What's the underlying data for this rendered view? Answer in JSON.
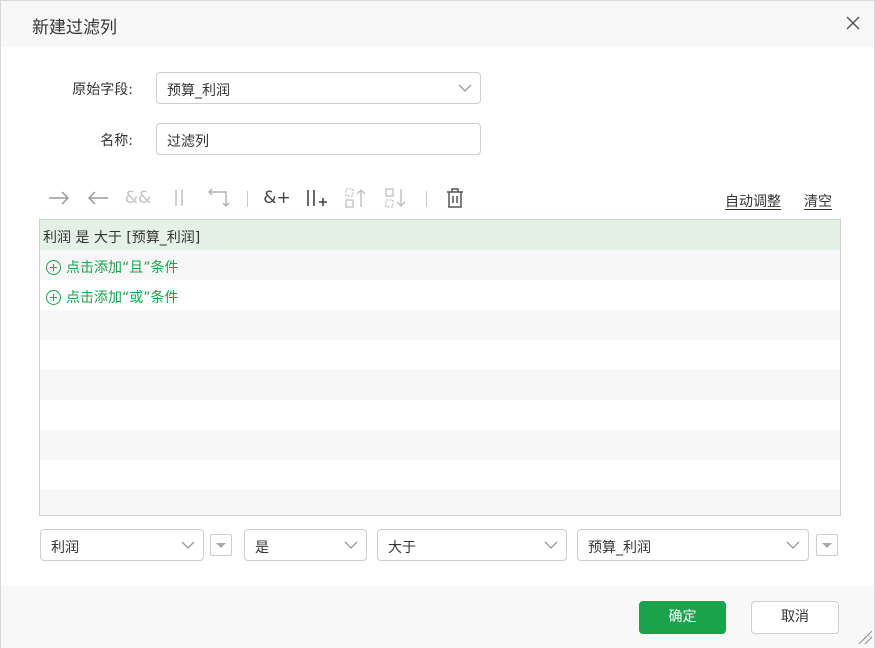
{
  "dialog": {
    "title": "新建过滤列",
    "close_icon": "close-icon"
  },
  "form": {
    "source_field_label": "原始字段:",
    "source_field_value": "预算_利润",
    "name_label": "名称:",
    "name_value": "过滤列"
  },
  "toolbar": {
    "icons": [
      "indent-right-icon",
      "indent-left-icon",
      "and-icon",
      "or-icon",
      "return-icon",
      "add-and-icon",
      "add-or-icon",
      "move-up-icon",
      "move-down-icon",
      "delete-icon"
    ],
    "and_glyph": "&&",
    "add_and_glyph": "&+",
    "auto_adjust": "自动调整",
    "clear": "清空"
  },
  "conditions": {
    "selected_condition": "利润 是 大于 [预算_利润]",
    "add_and": "点击添加“且”条件",
    "add_or": "点击添加“或”条件"
  },
  "editor": {
    "field": "利润",
    "is": "是",
    "operator": "大于",
    "value": "预算_利润"
  },
  "footer": {
    "confirm": "确定",
    "cancel": "取消"
  },
  "colors": {
    "accent": "#1aa34a",
    "selected_row": "#e3f1e6",
    "icon_gray": "#8a8a8a"
  }
}
